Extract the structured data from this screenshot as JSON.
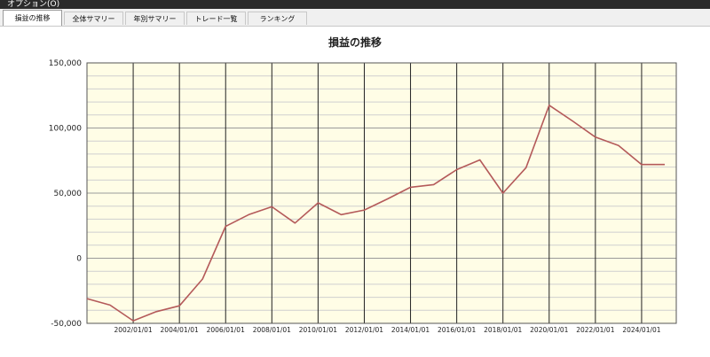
{
  "menubar": {
    "options_label": "オプション(O)"
  },
  "tabs": [
    {
      "label": "損益の推移",
      "active": true
    },
    {
      "label": "全体サマリー",
      "active": false
    },
    {
      "label": "年別サマリー",
      "active": false
    },
    {
      "label": "トレード一覧",
      "active": false
    },
    {
      "label": "ランキング",
      "active": false
    }
  ],
  "colors": {
    "plot_background": "#fffde6",
    "series_line": "#b45a5a",
    "major_grid": "#222222",
    "minor_grid": "#cfcfcf"
  },
  "chart_data": {
    "type": "line",
    "title": "損益の推移",
    "xlabel": "",
    "ylabel": "",
    "ylim": [
      -50000,
      150000
    ],
    "xlim": [
      "2000/01/01",
      "2025/07/01"
    ],
    "y_ticks": [
      "150,000",
      "100,000",
      "50,000",
      "0",
      "-50,000"
    ],
    "y_tick_values": [
      150000,
      100000,
      50000,
      0,
      -50000
    ],
    "x_ticks": [
      "2002/01/01",
      "2004/01/01",
      "2006/01/01",
      "2008/01/01",
      "2010/01/01",
      "2012/01/01",
      "2014/01/01",
      "2016/01/01",
      "2018/01/01",
      "2020/01/01",
      "2022/01/01",
      "2024/01/01"
    ],
    "grid": true,
    "series": [
      {
        "x": [
          "2000/01/01",
          "2001/01/01",
          "2002/01/01",
          "2003/01/01",
          "2004/01/01",
          "2005/01/01",
          "2006/01/01",
          "2007/01/01",
          "2008/01/01",
          "2009/01/01",
          "2010/01/01",
          "2011/01/01",
          "2012/01/01",
          "2013/01/01",
          "2014/01/01",
          "2015/01/01",
          "2016/01/01",
          "2017/01/01",
          "2018/01/01",
          "2019/01/01",
          "2020/01/01",
          "2021/01/01",
          "2022/01/01",
          "2023/01/01",
          "2024/01/01",
          "2025/01/01"
        ],
        "values": [
          -31000,
          -36000,
          -48000,
          -41000,
          -36500,
          -16000,
          24500,
          33500,
          39500,
          27000,
          42500,
          33500,
          37000,
          45500,
          54500,
          56500,
          68000,
          75500,
          50000,
          69500,
          117500,
          105500,
          93000,
          86500,
          72000,
          72000
        ]
      }
    ]
  }
}
